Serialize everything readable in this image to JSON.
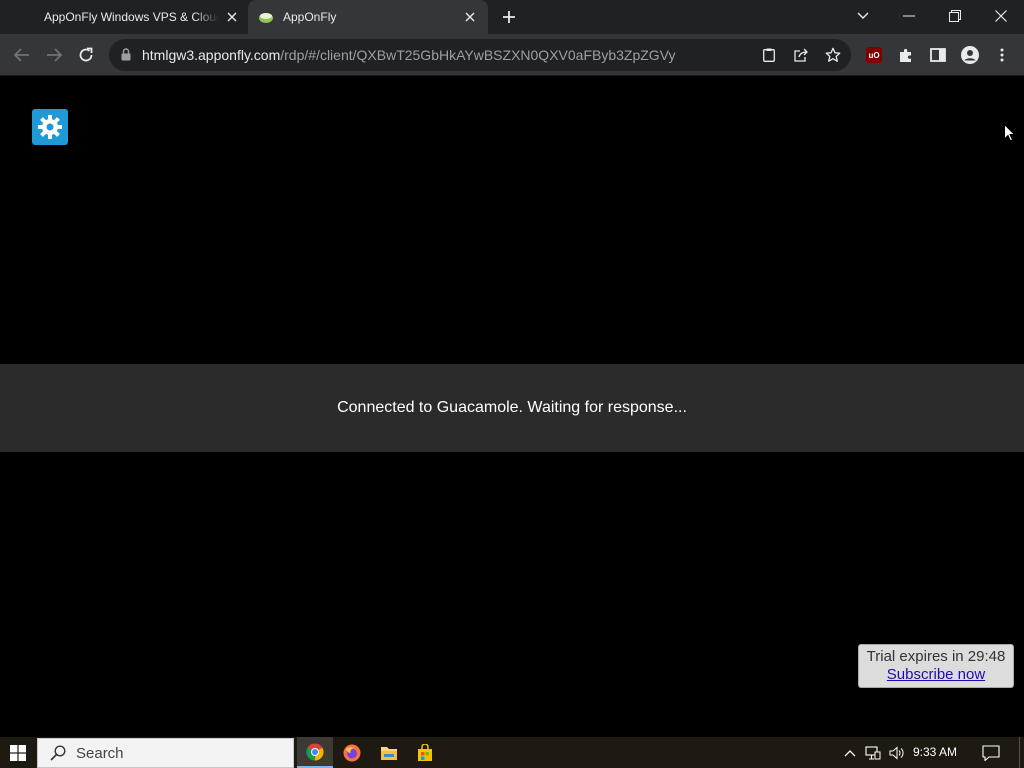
{
  "browser": {
    "tabs": [
      {
        "title": "AppOnFly Windows VPS & Cloud Desktops",
        "active": false
      },
      {
        "title": "AppOnFly",
        "active": true
      }
    ],
    "url_host": "htmlgw3.apponfly.com",
    "url_path": "/rdp/#/client/QXBwT25GbHkAYwBSZXN0QXV0aFByb3ZpZGVy"
  },
  "content": {
    "status_message": "Connected to Guacamole. Waiting for response...",
    "trial_text": "Trial expires in 29:48",
    "subscribe_label": "Subscribe now",
    "settings_accent": "#1f9ad7"
  },
  "taskbar": {
    "search_placeholder": "Search",
    "clock": "9:33 AM",
    "apps": [
      "chrome-icon",
      "firefox-icon",
      "file-explorer-icon",
      "store-icon"
    ]
  }
}
